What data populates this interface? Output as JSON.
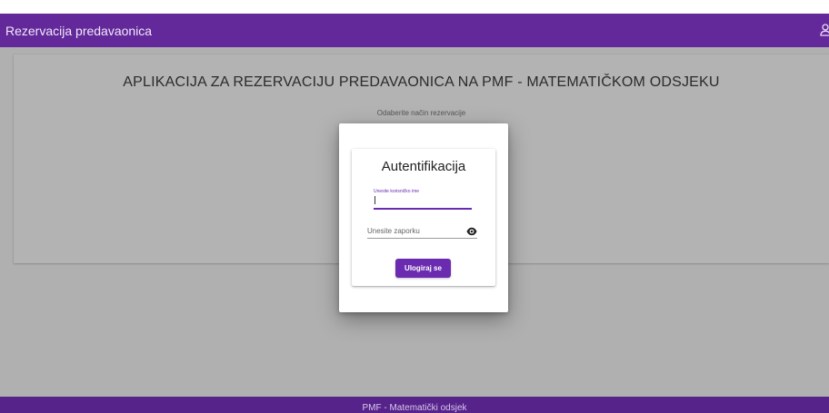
{
  "header": {
    "title": "Rezervacija predavaonica",
    "user_icon": "user-icon"
  },
  "main": {
    "heading": "APLIKACIJA ZA REZERVACIJU PREDAVAONICA NA PMF - MATEMATIČKOM ODSJEKU",
    "subtitle": "Odaberite način rezervacije"
  },
  "dialog": {
    "title": "Autentifikacija",
    "username": {
      "label": "Unesite korisničko ime",
      "value": ""
    },
    "password": {
      "placeholder": "Unesite zaporku",
      "value": "",
      "toggle_icon": "eye-icon"
    },
    "login_label": "Ulogiraj se"
  },
  "footer": {
    "text": "PMF - Matematički odsjek"
  },
  "colors": {
    "primary": "#63289a",
    "footer": "#55238a",
    "button": "#6a2bb0",
    "backdrop": "#b0b0b0"
  }
}
